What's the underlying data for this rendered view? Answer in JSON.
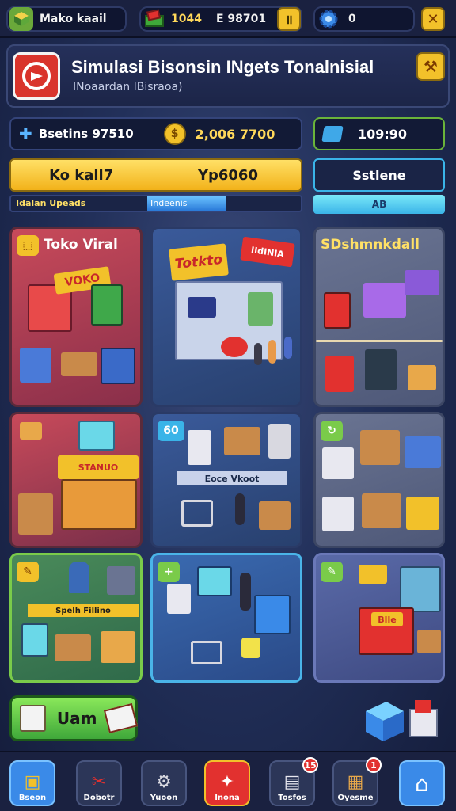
{
  "topbar": {
    "store_name": "Mako kaail",
    "cash": "1044",
    "money": "E 98701",
    "gems": "0"
  },
  "header": {
    "title": "Simulasi Bisonsin INgets Tonalnisial",
    "subtitle": "INoaardan IBisraoa)"
  },
  "stats": {
    "left_value": "Bsetins 97510",
    "coin_value": "2,006 7700",
    "right_value": "109:90"
  },
  "progress": {
    "left_label": "Ko kall7",
    "right_label": "Yp6060",
    "bottom_left": "Idalan Upeads",
    "bottom_mid": "Indeenis",
    "system_label": "Sstlene",
    "system_sub": "AB"
  },
  "cards": {
    "c1_label": "Toko Viral",
    "c1_sign": "VOKO",
    "c2_sign": "Totkto",
    "c2_sign2": "IIdINIA",
    "c3_label": "SDshmnkdall",
    "c4_sign": "STANUO",
    "c5_badge": "60",
    "c5_label": "Eoce Vkoot",
    "c7_label": "Spelh Fillino",
    "c9_sign": "Blle"
  },
  "action": {
    "label": "Uam"
  },
  "nav": [
    {
      "label": "Bseon"
    },
    {
      "label": "Dobotr"
    },
    {
      "label": "Yuoon"
    },
    {
      "label": "Inona"
    },
    {
      "label": "Tosfos",
      "badge": "15"
    },
    {
      "label": "Oyesme",
      "badge": "1"
    },
    {
      "label": ""
    }
  ],
  "colors": {
    "accent_yellow": "#f2b21a",
    "brand_red": "#e2312f",
    "bg": "#22305a"
  }
}
